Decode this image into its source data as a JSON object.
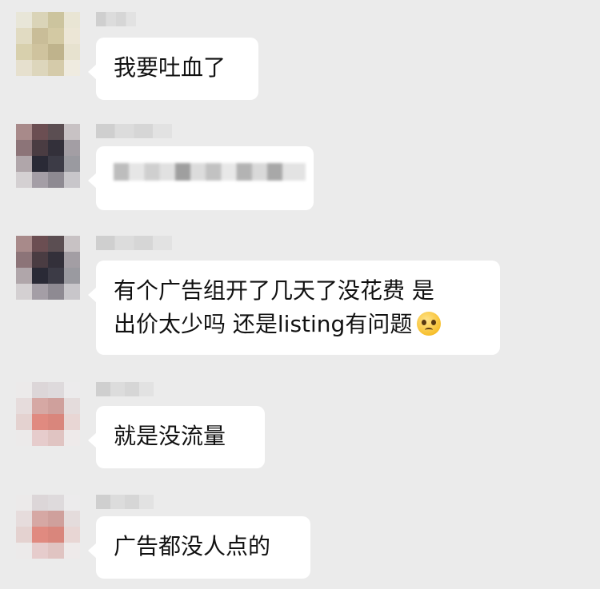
{
  "conversation": {
    "messages": [
      {
        "sender": "blurred",
        "text": "我要吐血了"
      },
      {
        "sender": "blurred",
        "text": ""
      },
      {
        "sender": "blurred",
        "line1": "有个广告组开了几天了没花费 是",
        "line2": "出价太少吗 还是listing有问题",
        "emoji_icon": "pleading-face-emoji-icon"
      },
      {
        "sender": "blurred",
        "text": "就是没流量"
      },
      {
        "sender": "blurred",
        "text": "广告都没人点的"
      }
    ]
  },
  "avatars": {
    "a1": [
      "#e8e6d8",
      "#dad4b8",
      "#ccc49e",
      "#e9e5d4",
      "#e1dbc2",
      "#c9bd98",
      "#d3c9a3",
      "#ece6d6",
      "#d8d0ad",
      "#cfc39e",
      "#bfb38c",
      "#e7e2cf",
      "#e6e0ce",
      "#ddd6bc",
      "#d5cbaa",
      "#efebe0"
    ],
    "a2": [
      "#a88a8a",
      "#6b4e52",
      "#5b4e52",
      "#c8c2c4",
      "#8c7478",
      "#4a3c42",
      "#33303a",
      "#a39ea4",
      "#b0a6aa",
      "#2a2a36",
      "#3c3b46",
      "#9a9aa0",
      "#d4d0d2",
      "#a49ea6",
      "#8e8a92",
      "#c8c6ca"
    ],
    "a3": [
      "#a88a8a",
      "#6b4e52",
      "#5b4e52",
      "#c8c2c4",
      "#8c7478",
      "#4a3c42",
      "#33303a",
      "#a39ea4",
      "#b0a6aa",
      "#2a2a36",
      "#3c3b46",
      "#9a9aa0",
      "#d4d0d2",
      "#a49ea6",
      "#8e8a92",
      "#c8c6ca"
    ],
    "a4": [
      "#eceaea",
      "#dcd6d8",
      "#dedadc",
      "#ecebec",
      "#e6dcdc",
      "#d6a8a4",
      "#cfa09c",
      "#e4dcdc",
      "#e4d2d0",
      "#e08a80",
      "#d9867c",
      "#e8d6d4",
      "#eceaea",
      "#e6cccc",
      "#e0c4c2",
      "#eeeaea"
    ],
    "a5": [
      "#eceaea",
      "#dcd6d8",
      "#dedadc",
      "#ecebec",
      "#e6dcdc",
      "#d6a8a4",
      "#cfa09c",
      "#e4dcdc",
      "#e4d2d0",
      "#e08a80",
      "#d9867c",
      "#e8d6d4",
      "#eceaea",
      "#e6cccc",
      "#e0c4c2",
      "#eeeaea"
    ]
  }
}
